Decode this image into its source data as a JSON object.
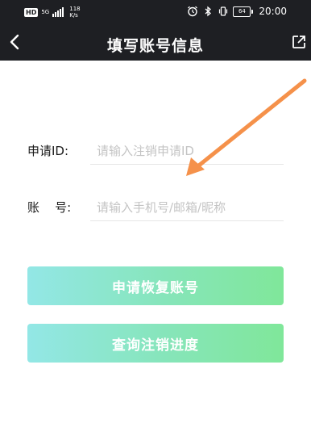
{
  "status_bar": {
    "hd": "HD",
    "network_gen": "5G",
    "speed_value": "118",
    "speed_unit": "K/s",
    "battery": "64",
    "time": "20:00"
  },
  "header": {
    "title": "填写账号信息"
  },
  "form": {
    "id_label": "申请ID:",
    "id_placeholder": "请输入注销申请ID",
    "account_label": "账    号:",
    "account_placeholder": "请输入手机号/邮箱/昵称"
  },
  "buttons": {
    "restore_label": "申请恢复账号",
    "query_label": "查询注销进度"
  },
  "colors": {
    "header_bg": "#1e1f23",
    "button_gradient_start": "#93e7e6",
    "button_gradient_end": "#80e79a",
    "annotation_arrow": "#f5914a"
  }
}
